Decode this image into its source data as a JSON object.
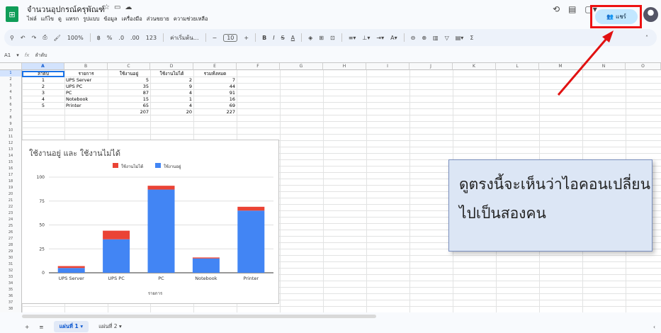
{
  "doc": {
    "title": "จำนวนอุปกรณ์ครุพัณฑ์",
    "menu": [
      "ไฟล์",
      "แก้ไข",
      "ดู",
      "แทรก",
      "รูปแบบ",
      "ข้อมูล",
      "เครื่องมือ",
      "ส่วนขยาย",
      "ความช่วยเหลือ"
    ],
    "share_label": "แชร์"
  },
  "toolbar": {
    "zoom": "100%",
    "pct": "%",
    "dec_dec": ".0",
    "dec_inc": ".00",
    "numfmt": "123",
    "font": "ค่าเริ่มต้น...",
    "minus": "−",
    "size": "10",
    "plus": "+",
    "bold": "B",
    "italic": "I",
    "strike": "S",
    "textcolor": "A",
    "sum": "Σ"
  },
  "formula_bar": {
    "cell_ref": "A1",
    "fx": "fx",
    "value": "ลำดับ"
  },
  "columns": [
    "A",
    "B",
    "C",
    "D",
    "E",
    "F",
    "G",
    "H",
    "I",
    "J",
    "K",
    "L",
    "M",
    "N",
    "O"
  ],
  "table": {
    "headers": [
      "ลำดับ",
      "รายการ",
      "ใช้งานอยู่",
      "ใช้งานไม่ได้",
      "รวมทั้งหมด"
    ],
    "rows": [
      [
        "1",
        "UPS Server",
        "5",
        "2",
        "7"
      ],
      [
        "2",
        "UPS PC",
        "35",
        "9",
        "44"
      ],
      [
        "3",
        "PC",
        "87",
        "4",
        "91"
      ],
      [
        "4",
        "Notebook",
        "15",
        "1",
        "16"
      ],
      [
        "5",
        "Printer",
        "65",
        "4",
        "69"
      ]
    ],
    "totals": [
      "207",
      "20",
      "227"
    ]
  },
  "chart_data": {
    "type": "bar",
    "stacked": true,
    "title": "ใช้งานอยู่ และ ใช้งานไม่ได้",
    "xlabel": "รายการ",
    "ylabel": "",
    "categories": [
      "UPS Server",
      "UPS PC",
      "PC",
      "Notebook",
      "Printer"
    ],
    "series": [
      {
        "name": "ใช้งานอยู่",
        "values": [
          5,
          35,
          87,
          15,
          65
        ],
        "color": "#4285f4"
      },
      {
        "name": "ใช้งานไม่ได้",
        "values": [
          2,
          9,
          4,
          1,
          4
        ],
        "color": "#ea4335"
      }
    ],
    "ylim": [
      0,
      100
    ],
    "yticks": [
      0,
      25,
      50,
      75,
      100
    ],
    "legend": "top-right"
  },
  "sheets": {
    "tab1": "แผ่นที่ 1",
    "tab2": "แผ่นที่ 2"
  },
  "callout": {
    "text": "ดูตรงนี้จะเห็นว่าไอคอนเปลี่ยนไปเป็นสองคน"
  },
  "annotation_color": "#e11111"
}
